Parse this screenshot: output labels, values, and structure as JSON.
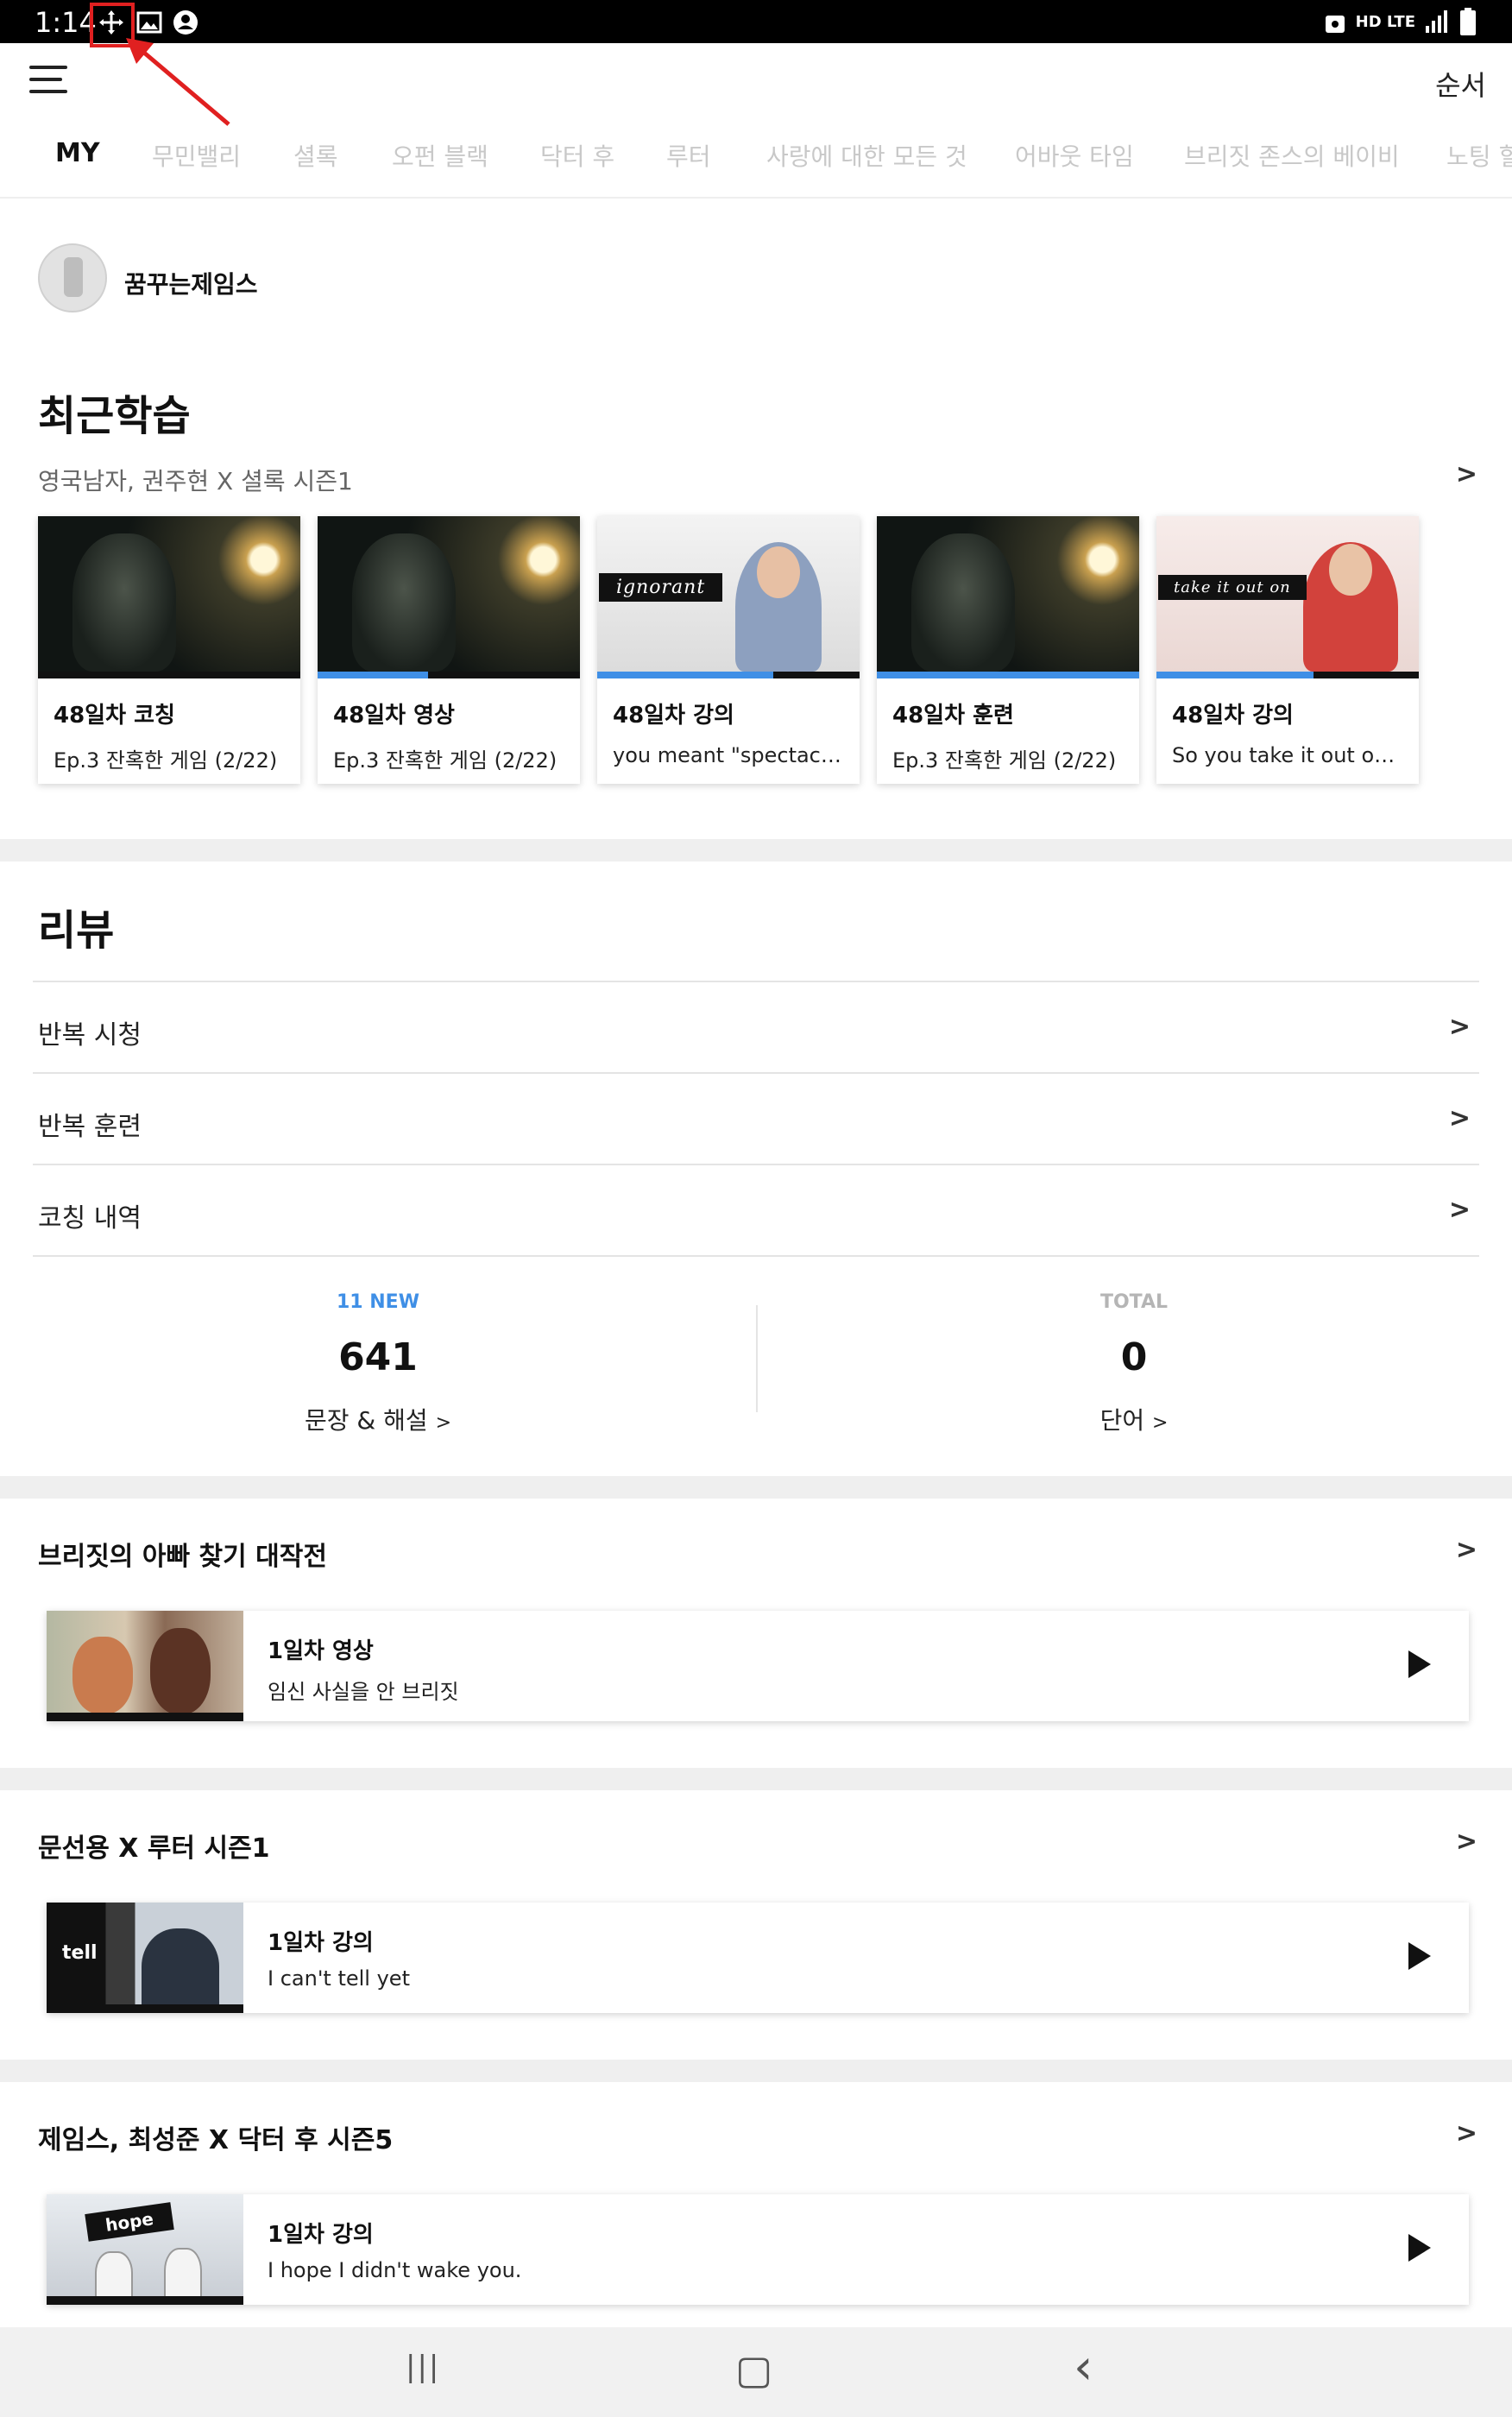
{
  "status_bar": {
    "time": "1:14",
    "left_icons": [
      "move-icon",
      "image-icon",
      "account-icon"
    ],
    "right_text": "HD LTE",
    "right_icons": [
      "hd-voice-icon",
      "signal-icon",
      "battery-icon"
    ],
    "annotation_color": "#e02020"
  },
  "header": {
    "menu_icon": "hamburger-menu-icon",
    "order_label": "순서"
  },
  "tabs": [
    {
      "label": "MY",
      "active": true
    },
    {
      "label": "무민밸리"
    },
    {
      "label": "셜록"
    },
    {
      "label": "오펀 블랙"
    },
    {
      "label": "닥터 후"
    },
    {
      "label": "루터"
    },
    {
      "label": "사랑에 대한 모든 것"
    },
    {
      "label": "어바웃 타임"
    },
    {
      "label": "브리짓 존스의 베이비"
    },
    {
      "label": "노팅 힐"
    }
  ],
  "profile": {
    "name": "꿈꾸는제임스"
  },
  "recent": {
    "title": "최근학습",
    "subtitle": "영국남자, 권주현 X 셜록 시즌1",
    "cards": [
      {
        "title": "48일차 코칭",
        "subtitle": "Ep.3 잔혹한 게임 (2/22)",
        "progress": 0,
        "thumb": "dark"
      },
      {
        "title": "48일차 영상",
        "subtitle": "Ep.3 잔혹한 게임 (2/22)",
        "progress": 0.42,
        "thumb": "dark"
      },
      {
        "title": "48일차 강의",
        "subtitle": "you meant \"spectacul…",
        "progress": 0.67,
        "thumb": "light",
        "tag": "ignorant"
      },
      {
        "title": "48일차 훈련",
        "subtitle": "Ep.3 잔혹한 게임 (2/22)",
        "progress": 1.0,
        "thumb": "dark"
      },
      {
        "title": "48일차 강의",
        "subtitle": "So you take it out on t…",
        "progress": 0.6,
        "thumb": "pink",
        "tag": "take it out on"
      }
    ]
  },
  "review": {
    "title": "리뷰",
    "rows": [
      "반복 시청",
      "반복 훈련",
      "코칭 내역"
    ],
    "stats": [
      {
        "top": "11 NEW",
        "value": "641",
        "label": "문장 & 해설",
        "top_color": "#3f8fe6"
      },
      {
        "top": "TOTAL",
        "value": "0",
        "label": "단어",
        "top_color": "#b5b5b5"
      }
    ]
  },
  "courses": [
    {
      "title": "브리짓의 아빠 찾기 대작전",
      "lesson": "1일차 영상",
      "desc": "임신 사실을 안 브리짓"
    },
    {
      "title": "문선용 X 루터 시즌1",
      "lesson": "1일차 강의",
      "desc": "I can't tell yet",
      "thumb_tag": "tell"
    },
    {
      "title": "제임스, 최성준 X 닥터 후 시즌5",
      "lesson": "1일차 강의",
      "desc": "I hope I didn't wake you.",
      "thumb_tag": "hope"
    }
  ],
  "navbar": {
    "recents_glyph": "|||",
    "home_glyph": "▢",
    "back_glyph": "‹"
  },
  "colors": {
    "accent": "#3f8fe6",
    "separator": "#efefef"
  }
}
